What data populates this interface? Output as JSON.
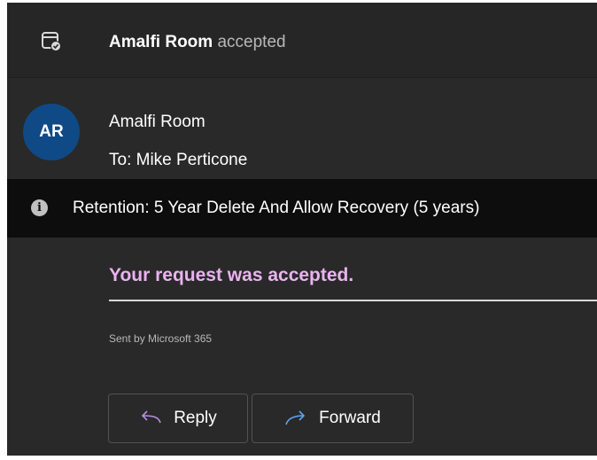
{
  "header": {
    "subject_bold": "Amalfi Room",
    "subject_suffix": " accepted",
    "icon": "calendar-check-icon"
  },
  "message": {
    "avatar_initials": "AR",
    "avatar_color": "#0f4a86",
    "sender_name": "Amalfi Room",
    "recipient_line": "To:  Mike Perticone"
  },
  "retention": {
    "icon": "info-icon",
    "icon_glyph": "i",
    "text": "Retention: 5 Year Delete And Allow Recovery (5 years)"
  },
  "body": {
    "title": "Your request was accepted.",
    "title_color": "#eab3f0",
    "footer_note": "Sent by Microsoft 365"
  },
  "actions": {
    "reply_label": "Reply",
    "reply_icon": "reply-arrow-icon",
    "reply_icon_color": "#b48ede",
    "forward_label": "Forward",
    "forward_icon": "forward-arrow-icon",
    "forward_icon_color": "#5ea5ef"
  }
}
